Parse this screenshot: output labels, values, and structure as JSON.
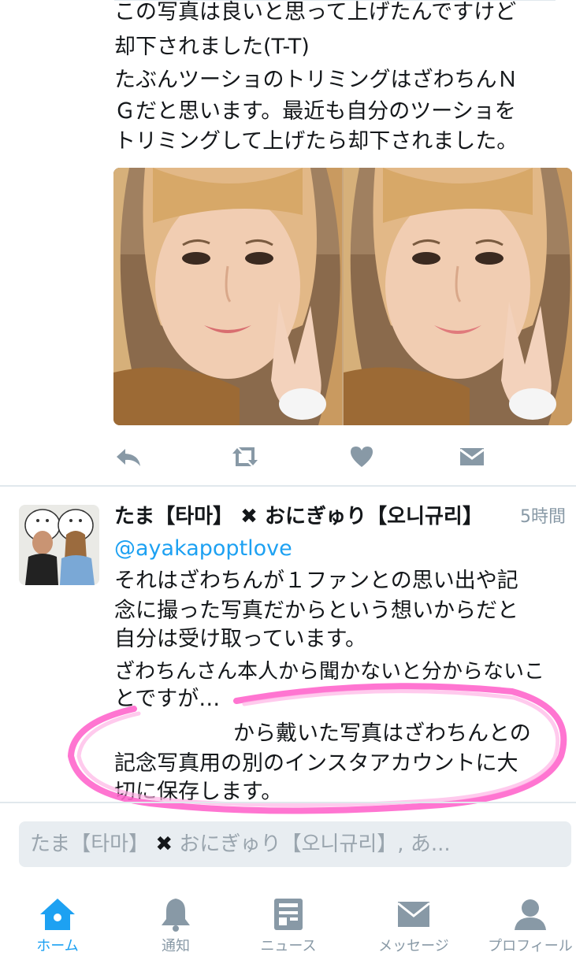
{
  "tweet1": {
    "lines": [
      "この写真は良いと思って上げたんですけど",
      "却下されました(T-T)",
      "たぶんツーショのトリミングはざわちんＮ",
      "Ｇだと思います。最近も自分のツーショを",
      "トリミングして上げたら却下されました。"
    ],
    "photos": [
      "photo-left",
      "photo-right"
    ],
    "actions": [
      "reply-icon",
      "retweet-icon",
      "like-icon",
      "message-icon"
    ]
  },
  "tweet2": {
    "name": "たま【타마】 ✖ おにぎゅり【오니규리】",
    "time": "5時間",
    "handle": "@ayakapoptlove",
    "lines": [
      "それはざわちんが１ファンとの思い出や記",
      "念に撮った写真だからという想いからだと",
      "自分は受け取っています。",
      "ざわちんさん本人から聞かないと分からないこ",
      "とですが…",
      "から戴いた写真はざわちんとの",
      "記念写真用の別のインスタアカウントに大",
      "切に保存します。"
    ]
  },
  "reply": {
    "placeholder_a": "たま【타마】 ",
    "placeholder_x": "✖",
    "placeholder_b": " おにぎゅり【오니규리】, あ..."
  },
  "tabs": [
    {
      "label": "ホーム",
      "icon": "home-icon",
      "active": true
    },
    {
      "label": "通知",
      "icon": "bell-icon",
      "active": false
    },
    {
      "label": "ニュース",
      "icon": "news-icon",
      "active": false
    },
    {
      "label": "メッセージ",
      "icon": "envelope-icon",
      "active": false
    },
    {
      "label": "プロフィール",
      "icon": "profile-icon",
      "active": false
    }
  ],
  "colors": {
    "accent": "#1da1f2",
    "icon": "#8899a6",
    "highlight": "#ff66cc"
  }
}
